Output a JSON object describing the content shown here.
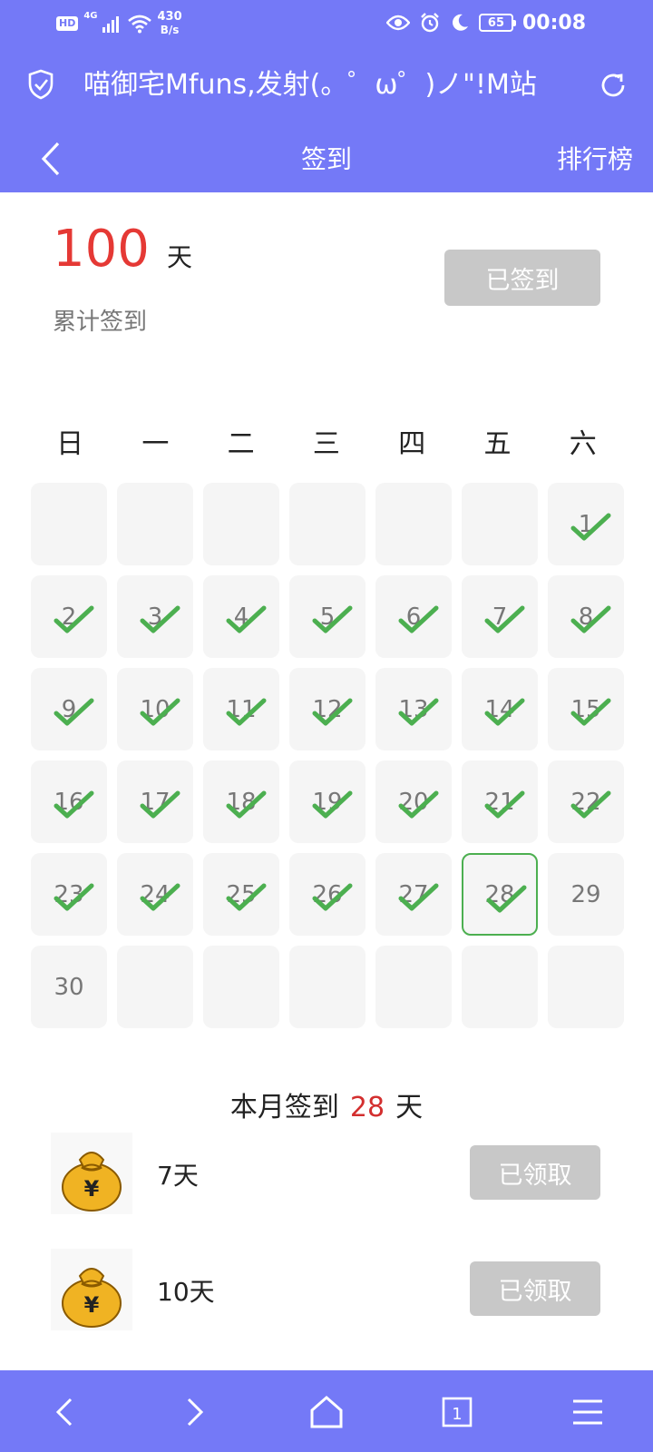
{
  "status_bar": {
    "network_badge": "HD",
    "network_type": "4G",
    "speed_value": "430",
    "speed_unit": "B/s",
    "battery": "65",
    "time": "00:08",
    "icons": [
      "eye-icon",
      "alarm-icon",
      "moon-icon"
    ]
  },
  "browser": {
    "page_title": "喵御宅Mfuns,发射(。゜ω゜)ノ\"!M站",
    "icons": [
      "shield-check-icon",
      "refresh-icon"
    ]
  },
  "nav": {
    "title": "签到",
    "right_action": "排行榜",
    "back_icon": "back-chevron-icon"
  },
  "summary": {
    "total_days": "100",
    "total_unit": "天",
    "total_label": "累计签到",
    "sign_button": "已签到"
  },
  "calendar": {
    "weekdays": [
      "日",
      "一",
      "二",
      "三",
      "四",
      "五",
      "六"
    ],
    "leading_blank_days": 6,
    "days_in_month": 30,
    "today": 28,
    "checked_days": [
      1,
      2,
      3,
      4,
      5,
      6,
      7,
      8,
      9,
      10,
      11,
      12,
      13,
      14,
      15,
      16,
      17,
      18,
      19,
      20,
      21,
      22,
      23,
      24,
      25,
      26,
      27,
      28
    ]
  },
  "month_summary": {
    "prefix": "本月签到",
    "count": "28",
    "suffix": "天"
  },
  "rewards": [
    {
      "label": "7天",
      "button": "已领取",
      "icon": "money-bag-icon"
    },
    {
      "label": "10天",
      "button": "已领取",
      "icon": "money-bag-icon"
    }
  ],
  "bottom_nav": [
    "back-icon",
    "forward-icon",
    "home-icon",
    "tabs-icon",
    "menu-icon"
  ],
  "bottom_nav_tab_count": "1",
  "colors": {
    "header": "#7479f7",
    "accent_red": "#e53935",
    "check_green": "#4caf50",
    "disabled_button": "#c8c8c8",
    "cell_bg": "#f5f5f5"
  }
}
